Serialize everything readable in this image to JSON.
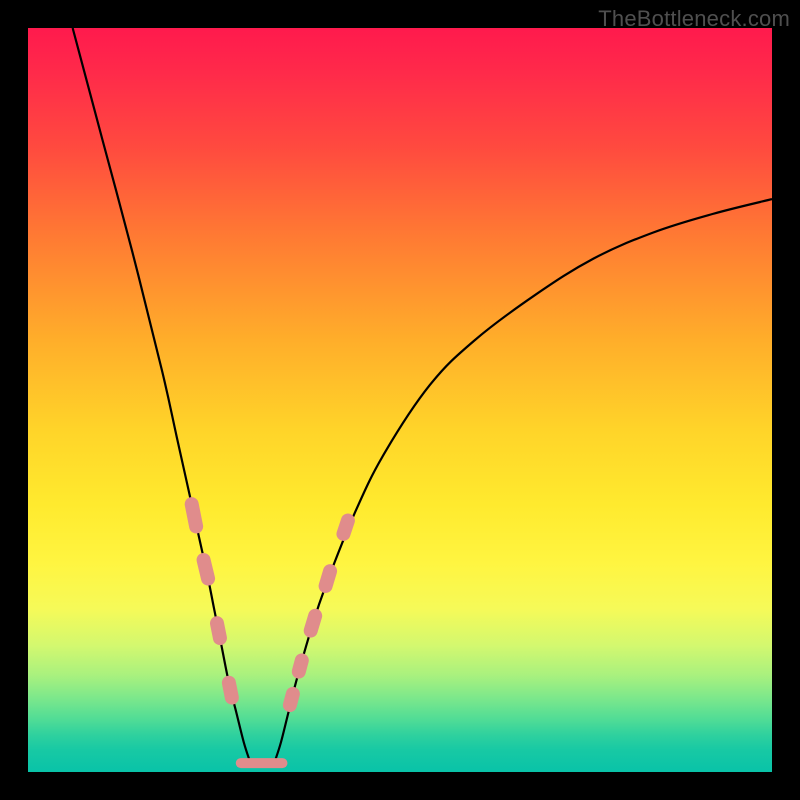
{
  "watermark": "TheBottleneck.com",
  "chart_data": {
    "type": "line",
    "title": "",
    "xlabel": "",
    "ylabel": "",
    "xlim": [
      0,
      100
    ],
    "ylim": [
      0,
      100
    ],
    "grid": false,
    "legend": false,
    "series": [
      {
        "name": "left-branch",
        "x": [
          6,
          10,
          14,
          18,
          20,
          22,
          24,
          25,
          26,
          27,
          28,
          29,
          29.8
        ],
        "y": [
          100,
          85,
          70,
          54,
          45,
          36,
          27,
          22,
          17,
          12,
          8,
          4,
          1.5
        ]
      },
      {
        "name": "right-branch",
        "x": [
          33.2,
          34,
          35,
          36,
          38,
          40,
          44,
          48,
          54,
          60,
          68,
          76,
          84,
          92,
          100
        ],
        "y": [
          1.5,
          4,
          8,
          12,
          19,
          25,
          35,
          43,
          52,
          58,
          64,
          69,
          72.5,
          75,
          77
        ]
      },
      {
        "name": "valley-markers-left",
        "points": [
          {
            "x": 22.0,
            "y": 36
          },
          {
            "x": 22.6,
            "y": 33
          },
          {
            "x": 23.6,
            "y": 28.5
          },
          {
            "x": 24.2,
            "y": 26
          },
          {
            "x": 25.4,
            "y": 20
          },
          {
            "x": 25.8,
            "y": 18
          },
          {
            "x": 27.0,
            "y": 12
          },
          {
            "x": 27.4,
            "y": 10
          }
        ]
      },
      {
        "name": "valley-markers-right",
        "points": [
          {
            "x": 35.2,
            "y": 9
          },
          {
            "x": 35.6,
            "y": 10.5
          },
          {
            "x": 36.4,
            "y": 13.5
          },
          {
            "x": 36.8,
            "y": 15
          },
          {
            "x": 38.0,
            "y": 19
          },
          {
            "x": 38.6,
            "y": 21
          },
          {
            "x": 40.0,
            "y": 25
          },
          {
            "x": 40.6,
            "y": 27
          },
          {
            "x": 42.4,
            "y": 32
          },
          {
            "x": 43.0,
            "y": 33.8
          }
        ]
      },
      {
        "name": "valley-floor",
        "x": [
          28.6,
          34.2
        ],
        "y": [
          1.2,
          1.2
        ]
      }
    ]
  }
}
